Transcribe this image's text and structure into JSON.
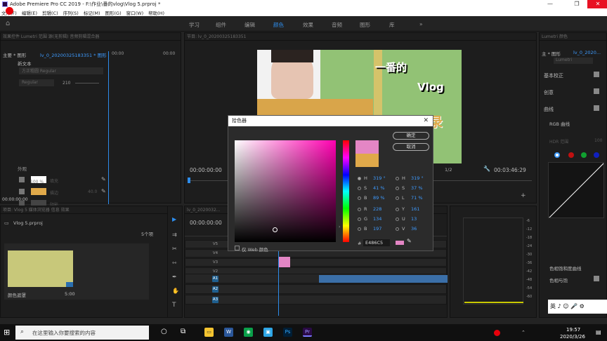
{
  "titlebar": {
    "title": "Adobe Premiere Pro CC 2019 - F:\\作业\\番的vlog\\Vlog 5.prproj *",
    "minimize": "—",
    "restore": "❐",
    "close": "✕"
  },
  "menu": [
    "文件(F)",
    "编辑(E)",
    "剪辑(C)",
    "序列(S)",
    "标记(M)",
    "图形(G)",
    "窗口(W)",
    "帮助(H)"
  ],
  "workspace_tabs": [
    "学习",
    "组件",
    "编辑",
    "颜色",
    "效果",
    "音频",
    "图形",
    "库"
  ],
  "workspace_active": "颜色",
  "workspace_more": "»",
  "left_top": {
    "header": "效果控件  Lumetri 范围  源(无剪辑)  音频剪辑混合器",
    "source_label": "主要 * 图形",
    "clip_label": "lv_0_20200325183351 * 图形",
    "time_start": "00:00",
    "time_end": "00:00",
    "text_layer": "新文本",
    "font_name": "方正粗圆 Regular",
    "font_style": "Regular",
    "font_size": "210",
    "appearance_label": "外观",
    "fill_label": "填充",
    "stroke_label": "描边",
    "stroke_value": "40.0",
    "shadow_label": "阴影",
    "opacity_value": "100 %",
    "bottom_time": "00:00:00:00"
  },
  "project": {
    "header": "项目: Vlog 5  媒体浏览器  信息  效果",
    "file": "Vlog 5.prproj",
    "count": "5个项",
    "item_label": "颜色遮罩",
    "item_duration": "5:00"
  },
  "program": {
    "header": "节目: lv_0_20200325183351",
    "time_left": "00:00:00:00",
    "zoom": "1/2",
    "time_right": "00:03:46:29",
    "overlay_text_1": "一番的",
    "overlay_text_2": "Vlog",
    "overlay_text_3": "录"
  },
  "timeline": {
    "header": "lv_0_2020032...",
    "timecode": "00:00:00:00",
    "tracks_video": [
      "V5",
      "V4",
      "V3",
      "V2"
    ],
    "tracks_audio": [
      "A1",
      "A2",
      "A3"
    ]
  },
  "lumetri": {
    "header": "Lumetri 颜色",
    "source_label": "主 * 图形",
    "clip_label": "lv_0_2020...",
    "preset": "Lumetri",
    "sections": [
      "基本校正",
      "创意",
      "曲线"
    ],
    "rgb_curve": "RGB 曲线",
    "hdr_range": "HDR 范围",
    "hdr_value": "100",
    "hue_sat": "色相饱和度曲线",
    "hue_vs": "色相与饱",
    "footer_text": "英 ♪ ☺ 🎤 ⚙"
  },
  "scope": {
    "ticks": [
      "-6",
      "-12",
      "-18",
      "-24",
      "-30",
      "-36",
      "-42",
      "-48",
      "-54",
      "-60"
    ]
  },
  "picker": {
    "title": "拾色器",
    "ok": "确定",
    "cancel": "取消",
    "new_color": "#e486c5",
    "old_color": "#e0a94a",
    "fields": [
      {
        "label": "H",
        "value": "319 °"
      },
      {
        "label": "S",
        "value": "41 %"
      },
      {
        "label": "B",
        "value": "89 %"
      },
      {
        "label": "R",
        "value": "228"
      },
      {
        "label": "G",
        "value": "134"
      },
      {
        "label": "B",
        "value": "197"
      }
    ],
    "fields2": [
      {
        "label": "H",
        "value": "319 °"
      },
      {
        "label": "S",
        "value": "37 %"
      },
      {
        "label": "L",
        "value": "71 %"
      },
      {
        "label": "Y",
        "value": "161"
      },
      {
        "label": "U",
        "value": "13"
      },
      {
        "label": "V",
        "value": "36"
      }
    ],
    "hex_label": "#",
    "hex_value": "E486C5",
    "web_only": "仅 Web 颜色"
  },
  "taskbar": {
    "search_placeholder": "在这里输入你要搜索的内容",
    "time": "19:57",
    "date": "2020/3/26"
  }
}
